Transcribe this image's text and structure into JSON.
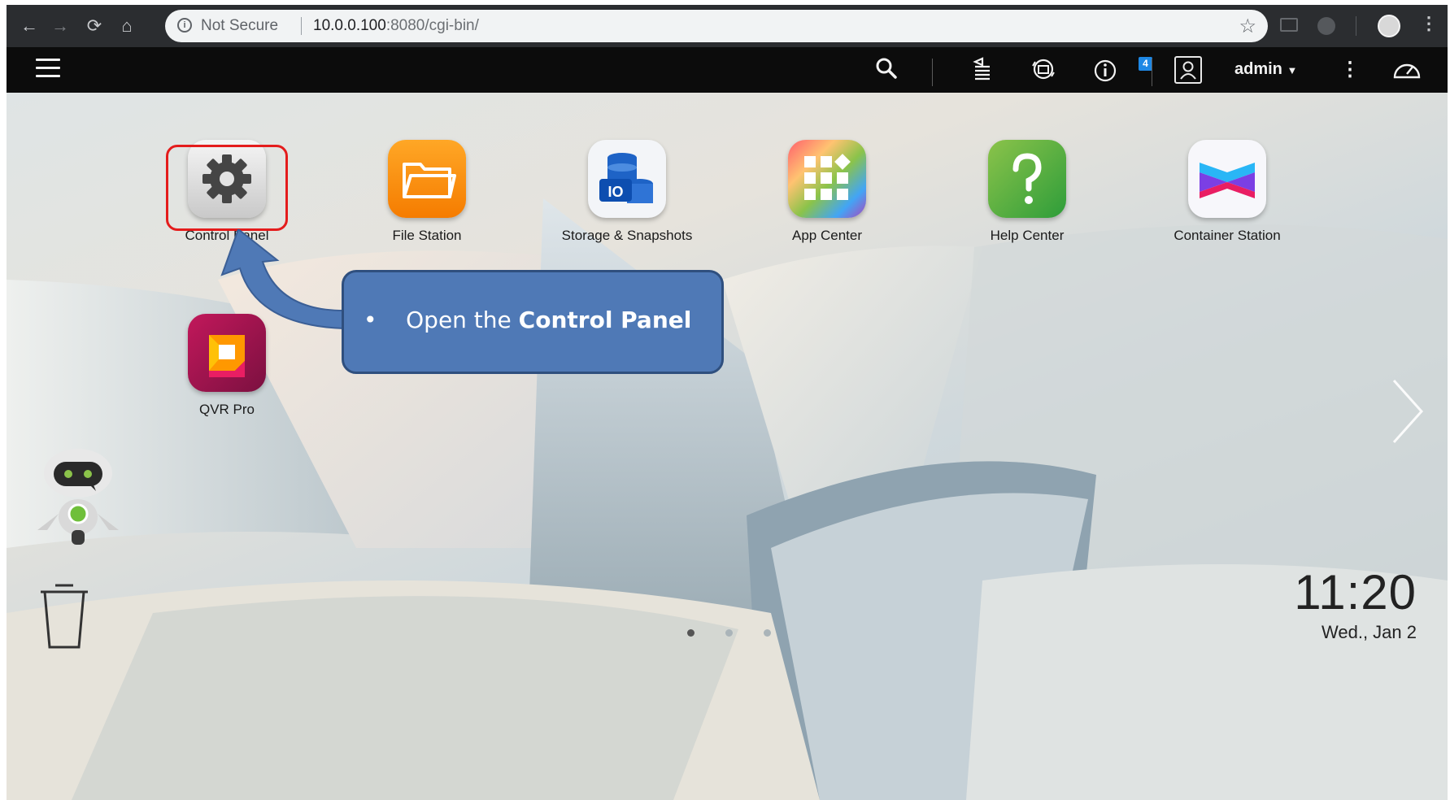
{
  "browser": {
    "security_label": "Not Secure",
    "url_host": "10.0.0.100",
    "url_rest": ":8080/cgi-bin/"
  },
  "topbar": {
    "notification_count": "4",
    "user_name": "admin"
  },
  "apps": [
    {
      "label": "Control Panel",
      "icon": "gear-icon"
    },
    {
      "label": "File Station",
      "icon": "folder-icon"
    },
    {
      "label": "Storage & Snapshots",
      "icon": "storage-icon"
    },
    {
      "label": "App Center",
      "icon": "grid-icon"
    },
    {
      "label": "Help Center",
      "icon": "question-icon"
    },
    {
      "label": "Container Station",
      "icon": "container-icon"
    },
    {
      "label": "QVR Pro",
      "icon": "qvr-icon"
    }
  ],
  "callout": {
    "prefix": "Open the ",
    "emphasis": "Control Panel"
  },
  "clock": {
    "time": "11:20",
    "date": "Wed., Jan 2"
  },
  "pagination": {
    "pages": 3,
    "current": 1
  },
  "colors": {
    "highlight": "#e41c1c",
    "callout_fill": "#4f79b6",
    "topbar": "#0c0c0c"
  }
}
